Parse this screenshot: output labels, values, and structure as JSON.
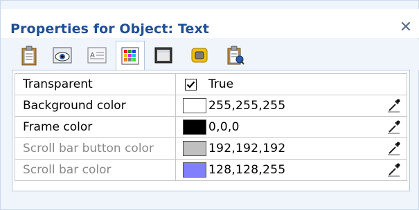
{
  "window": {
    "title": "Properties for Object: Text",
    "close_icon": "close-icon"
  },
  "toolbar": {
    "tabs": [
      {
        "name": "general",
        "icon": "clipboard-icon",
        "active": false
      },
      {
        "name": "visibility",
        "icon": "eye-icon",
        "active": false
      },
      {
        "name": "text",
        "icon": "text-format-icon",
        "active": false
      },
      {
        "name": "colors",
        "icon": "color-palette-icon",
        "active": true
      },
      {
        "name": "frame",
        "icon": "frame-icon",
        "active": false
      },
      {
        "name": "style",
        "icon": "style-icon",
        "active": false
      },
      {
        "name": "events",
        "icon": "events-icon",
        "active": false
      }
    ]
  },
  "properties": [
    {
      "label": "Transparent",
      "type": "checkbox",
      "checked": true,
      "value": "True",
      "enabled": true
    },
    {
      "label": "Background color",
      "type": "color",
      "color": "#ffffff",
      "value": "255,255,255",
      "enabled": true
    },
    {
      "label": "Frame color",
      "type": "color",
      "color": "#000000",
      "value": "0,0,0",
      "enabled": true
    },
    {
      "label": "Scroll bar button color",
      "type": "color",
      "color": "#c0c0c0",
      "value": "192,192,192",
      "enabled": false
    },
    {
      "label": "Scroll bar color",
      "type": "color",
      "color": "#8080ff",
      "value": "128,128,255",
      "enabled": false
    }
  ],
  "colors": {
    "title": "#1f4e93",
    "accent_border": "#b4c6df",
    "disabled_text": "#8a8a8a"
  }
}
